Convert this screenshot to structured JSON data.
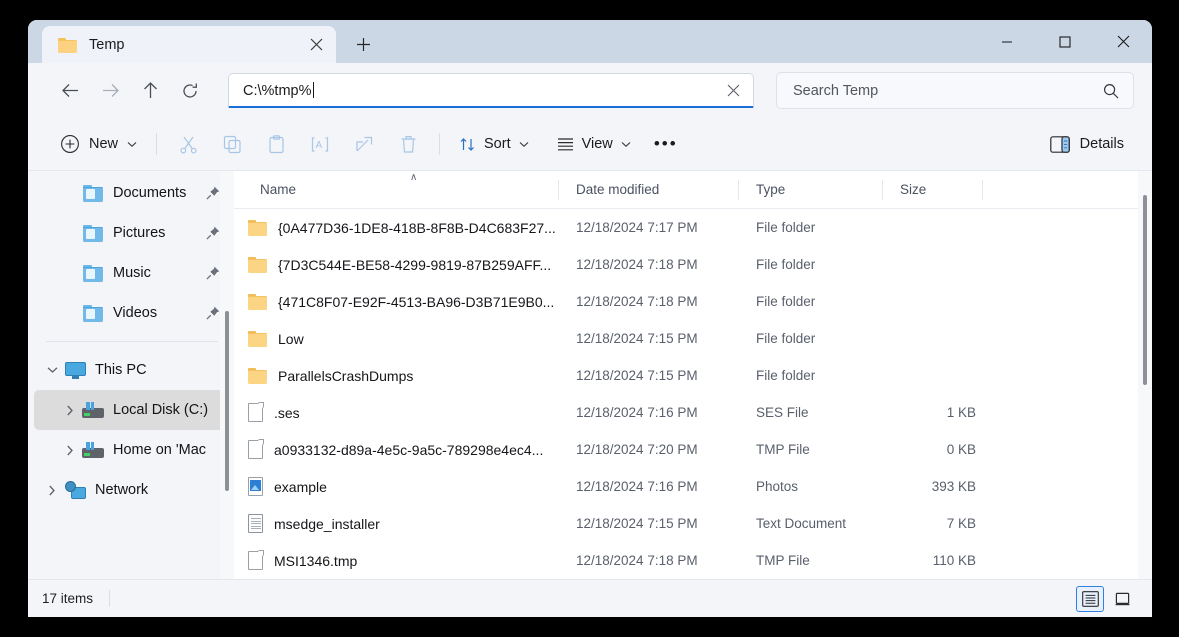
{
  "window": {
    "tab_title": "Temp",
    "tab_icon": "folder-icon",
    "close_tab_icon": "close-icon",
    "new_tab_icon": "plus-icon",
    "minimize_icon": "minimize-icon",
    "maximize_icon": "maximize-icon",
    "close_icon": "close-icon"
  },
  "nav": {
    "back_icon": "arrow-left-icon",
    "forward_icon": "arrow-right-icon",
    "up_icon": "arrow-up-icon",
    "refresh_icon": "refresh-icon"
  },
  "address": {
    "value": "C:\\%tmp%",
    "clear_icon": "close-icon"
  },
  "search": {
    "placeholder": "Search Temp",
    "icon": "search-icon"
  },
  "toolbar": {
    "new_label": "New",
    "new_icon": "plus-circle-icon",
    "cut_icon": "scissors-icon",
    "copy_icon": "copy-icon",
    "paste_icon": "paste-icon",
    "rename_icon": "rename-icon",
    "share_icon": "share-icon",
    "delete_icon": "trash-icon",
    "sort_label": "Sort",
    "sort_icon": "sort-arrows-icon",
    "view_label": "View",
    "view_icon": "list-lines-icon",
    "more_label": "•••",
    "details_label": "Details",
    "details_icon": "details-pane-icon"
  },
  "sidebar": {
    "items": [
      {
        "label": "Documents",
        "icon": "folder-documents-icon",
        "indent": 2,
        "caret": "none",
        "pinned": true,
        "selected": false
      },
      {
        "label": "Pictures",
        "icon": "folder-pictures-icon",
        "indent": 2,
        "caret": "none",
        "pinned": true,
        "selected": false
      },
      {
        "label": "Music",
        "icon": "folder-music-icon",
        "indent": 2,
        "caret": "none",
        "pinned": true,
        "selected": false
      },
      {
        "label": "Videos",
        "icon": "folder-videos-icon",
        "indent": 2,
        "caret": "none",
        "pinned": true,
        "selected": false
      },
      {
        "label": "This PC",
        "icon": "this-pc-icon",
        "indent": 1,
        "caret": "down",
        "pinned": false,
        "selected": false
      },
      {
        "label": "Local Disk (C:)",
        "icon": "disk-icon",
        "indent": 2,
        "caret": "right",
        "pinned": false,
        "selected": true
      },
      {
        "label": "Home on 'Mac",
        "icon": "disk-icon",
        "indent": 2,
        "caret": "right",
        "pinned": false,
        "selected": false
      },
      {
        "label": "Network",
        "icon": "network-icon",
        "indent": 1,
        "caret": "right",
        "pinned": false,
        "selected": false
      }
    ]
  },
  "columns": {
    "name": "Name",
    "date_modified": "Date modified",
    "type": "Type",
    "size": "Size",
    "sort_indicator": "∧"
  },
  "files": [
    {
      "name": "{0A477D36-1DE8-418B-8F8B-D4C683F27...",
      "date": "12/18/2024 7:17 PM",
      "type": "File folder",
      "size": "",
      "icon": "folder-icon"
    },
    {
      "name": "{7D3C544E-BE58-4299-9819-87B259AFF...",
      "date": "12/18/2024 7:18 PM",
      "type": "File folder",
      "size": "",
      "icon": "folder-icon"
    },
    {
      "name": "{471C8F07-E92F-4513-BA96-D3B71E9B0...",
      "date": "12/18/2024 7:18 PM",
      "type": "File folder",
      "size": "",
      "icon": "folder-icon"
    },
    {
      "name": "Low",
      "date": "12/18/2024 7:15 PM",
      "type": "File folder",
      "size": "",
      "icon": "folder-icon"
    },
    {
      "name": "ParallelsCrashDumps",
      "date": "12/18/2024 7:15 PM",
      "type": "File folder",
      "size": "",
      "icon": "folder-icon"
    },
    {
      "name": ".ses",
      "date": "12/18/2024 7:16 PM",
      "type": "SES File",
      "size": "1 KB",
      "icon": "file-icon"
    },
    {
      "name": "a0933132-d89a-4e5c-9a5c-789298e4ec4...",
      "date": "12/18/2024 7:20 PM",
      "type": "TMP File",
      "size": "0 KB",
      "icon": "file-icon"
    },
    {
      "name": "example",
      "date": "12/18/2024 7:16 PM",
      "type": "Photos",
      "size": "393 KB",
      "icon": "photo-icon"
    },
    {
      "name": "msedge_installer",
      "date": "12/18/2024 7:15 PM",
      "type": "Text Document",
      "size": "7 KB",
      "icon": "text-icon"
    },
    {
      "name": "MSI1346.tmp",
      "date": "12/18/2024 7:18 PM",
      "type": "TMP File",
      "size": "110 KB",
      "icon": "file-icon"
    }
  ],
  "status": {
    "item_count": "17 items",
    "details_view_icon": "details-view-icon",
    "thumbnail_view_icon": "large-icons-view-icon"
  },
  "colors": {
    "accent": "#1a6fd4",
    "titlebar": "#ccd7e6",
    "chrome": "#f3f5f9",
    "folder_yellow": "#fcd584",
    "folder_blue": "#72b9ea"
  }
}
